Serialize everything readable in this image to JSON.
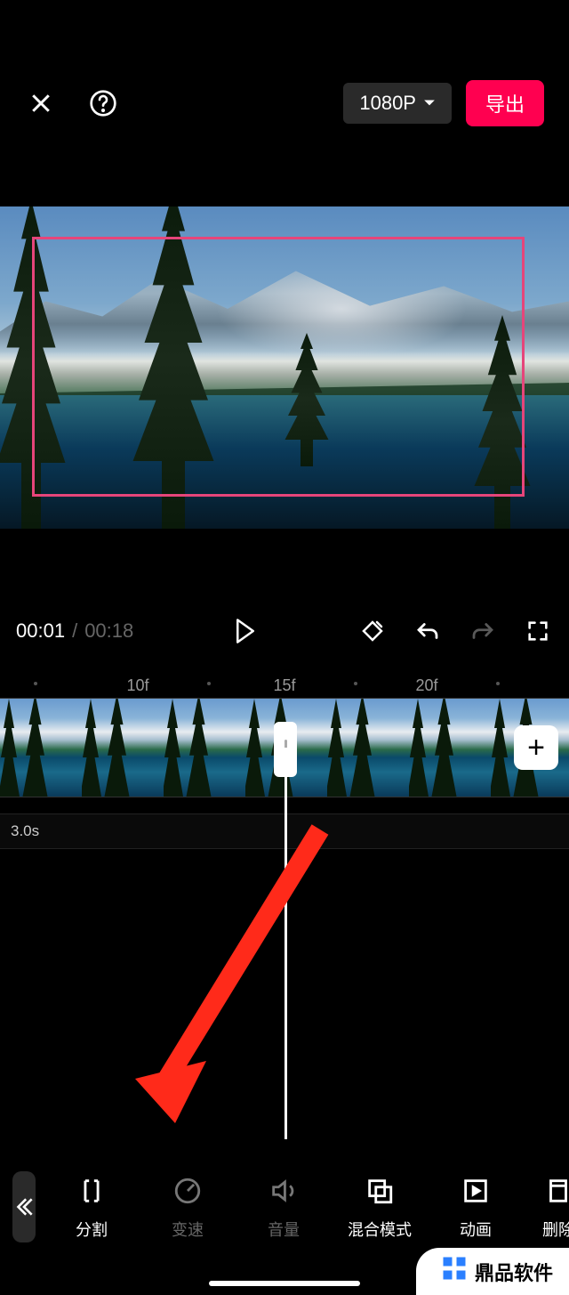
{
  "header": {
    "resolution_label": "1080P",
    "export_label": "导出"
  },
  "playback": {
    "current_time": "00:01",
    "separator": "/",
    "duration": "00:18"
  },
  "ruler": {
    "labels": [
      "10f",
      "15f",
      "20f"
    ]
  },
  "timeline": {
    "track2_duration": "3.0s",
    "add_label": "+"
  },
  "toolbar": {
    "items": [
      {
        "id": "split",
        "label": "分割",
        "dim": false
      },
      {
        "id": "speed",
        "label": "变速",
        "dim": true
      },
      {
        "id": "volume",
        "label": "音量",
        "dim": true
      },
      {
        "id": "blend",
        "label": "混合模式",
        "dim": false
      },
      {
        "id": "anim",
        "label": "动画",
        "dim": false
      },
      {
        "id": "delete",
        "label": "删除",
        "dim": false
      }
    ]
  },
  "watermark": {
    "text": "鼎品软件"
  }
}
